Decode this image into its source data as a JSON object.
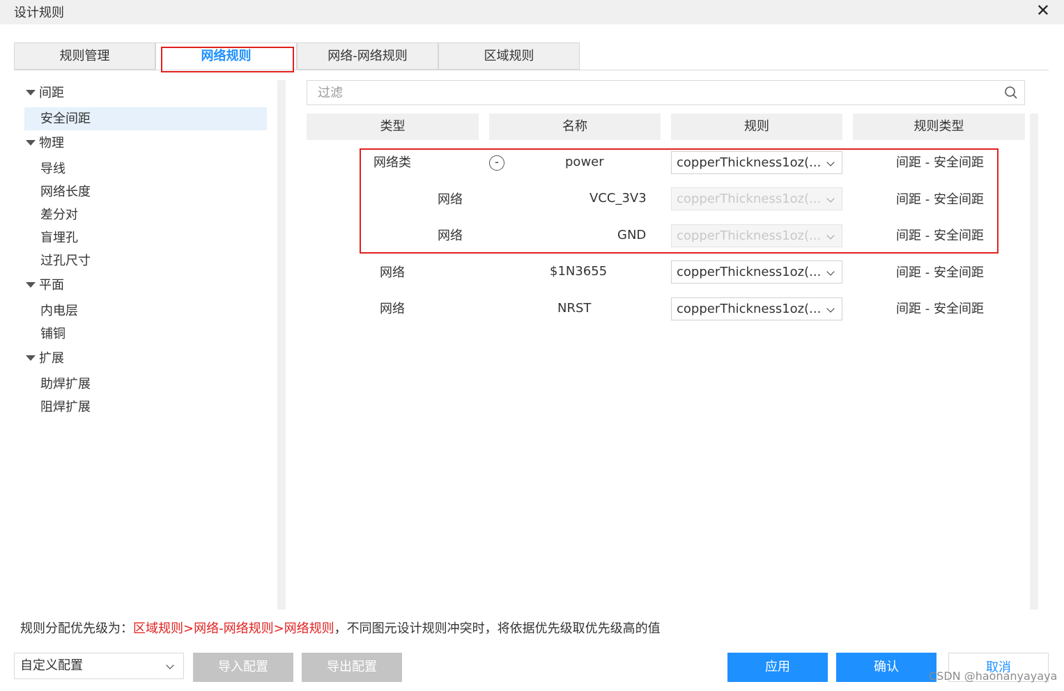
{
  "window": {
    "title": "设计规则",
    "close_glyph": "✕"
  },
  "tabs": [
    {
      "label": "规则管理"
    },
    {
      "label": "网络规则"
    },
    {
      "label": "网络-网络规则"
    },
    {
      "label": "区域规则"
    }
  ],
  "tree": {
    "groups": [
      {
        "label": "间距",
        "items": [
          "安全间距"
        ]
      },
      {
        "label": "物理",
        "items": [
          "导线",
          "网络长度",
          "差分对",
          "盲埋孔",
          "过孔尺寸"
        ]
      },
      {
        "label": "平面",
        "items": [
          "内电层",
          "铺铜"
        ]
      },
      {
        "label": "扩展",
        "items": [
          "助焊扩展",
          "阻焊扩展"
        ]
      }
    ],
    "selected": "安全间距"
  },
  "filter": {
    "placeholder": "过滤",
    "value": ""
  },
  "table": {
    "columns": [
      "类型",
      "名称",
      "规则",
      "规则类型"
    ],
    "rows": [
      {
        "type": "网络类",
        "name": "power",
        "rule": "copperThickness1oz(...",
        "rule_type": "间距 - 安全间距",
        "collapse": "-",
        "disabled": false
      },
      {
        "type": "网络",
        "name": "VCC_3V3",
        "rule": "copperThickness1oz(...",
        "rule_type": "间距 - 安全间距",
        "disabled": true
      },
      {
        "type": "网络",
        "name": "GND",
        "rule": "copperThickness1oz(...",
        "rule_type": "间距 - 安全间距",
        "disabled": true
      },
      {
        "type": "网络",
        "name": "$1N3655",
        "rule": "copperThickness1oz(...",
        "rule_type": "间距 - 安全间距",
        "disabled": false
      },
      {
        "type": "网络",
        "name": "NRST",
        "rule": "copperThickness1oz(...",
        "rule_type": "间距 - 安全间距",
        "disabled": false
      }
    ]
  },
  "footer": {
    "note_prefix": "规则分配优先级为：",
    "note_priority": "区域规则>网络-网络规则>网络规则",
    "note_suffix": "，不同图元设计规则冲突时，将依据优先级取优先级高的值",
    "config_select": "自定义配置",
    "import_label": "导入配置",
    "export_label": "导出配置",
    "apply_label": "应用",
    "confirm_label": "确认",
    "cancel_label": "取消"
  },
  "watermark": "CSDN @haonanyayaya",
  "colors": {
    "accent": "#1e90ff",
    "highlight": "#e0201e"
  }
}
